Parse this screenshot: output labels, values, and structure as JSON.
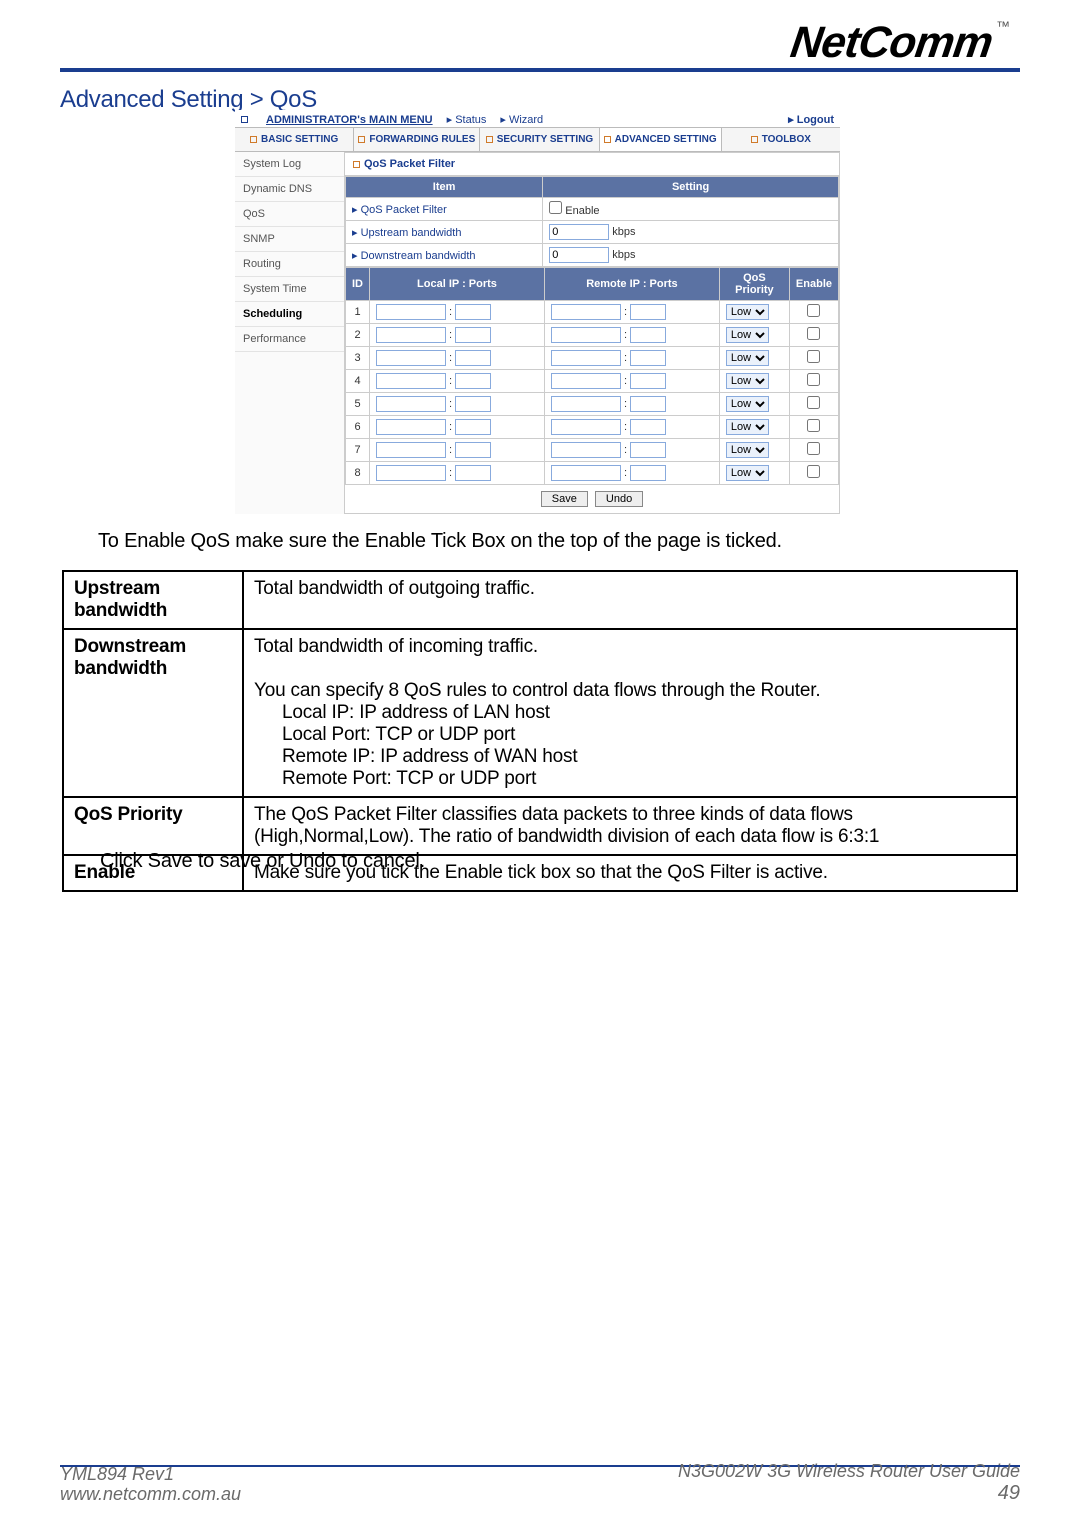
{
  "logo": {
    "text": "NetComm",
    "tm": "™"
  },
  "heading": "Advanced Setting > QoS",
  "router": {
    "topbar": {
      "main_menu": "ADMINISTRATOR's MAIN MENU",
      "status": "Status",
      "wizard": "Wizard",
      "logout": "Logout"
    },
    "tabs": [
      "BASIC SETTING",
      "FORWARDING RULES",
      "SECURITY SETTING",
      "ADVANCED SETTING",
      "TOOLBOX"
    ],
    "active_tab_index": 3,
    "sidebar": [
      "System Log",
      "Dynamic DNS",
      "QoS",
      "SNMP",
      "Routing",
      "System Time",
      "Scheduling",
      "Performance"
    ],
    "sidebar_active_index": 6,
    "panel_title": "QoS Packet Filter",
    "cfg_header": {
      "item": "Item",
      "setting": "Setting"
    },
    "cfg_rows": {
      "qos_pf": {
        "label": "QoS Packet Filter",
        "setting_label": "Enable",
        "checked": false
      },
      "up": {
        "label": "Upstream bandwidth",
        "value": "0",
        "unit": "kbps"
      },
      "down": {
        "label": "Downstream bandwidth",
        "value": "0",
        "unit": "kbps"
      }
    },
    "qos_headers": {
      "id": "ID",
      "local": "Local IP : Ports",
      "remote": "Remote IP : Ports",
      "priority": "QoS Priority",
      "enable": "Enable"
    },
    "qos_rows": [
      {
        "id": 1,
        "priority": "Low",
        "checked": false
      },
      {
        "id": 2,
        "priority": "Low",
        "checked": false
      },
      {
        "id": 3,
        "priority": "Low",
        "checked": false
      },
      {
        "id": 4,
        "priority": "Low",
        "checked": false
      },
      {
        "id": 5,
        "priority": "Low",
        "checked": false
      },
      {
        "id": 6,
        "priority": "Low",
        "checked": false
      },
      {
        "id": 7,
        "priority": "Low",
        "checked": false
      },
      {
        "id": 8,
        "priority": "Low",
        "checked": false
      }
    ],
    "buttons": {
      "save": "Save",
      "undo": "Undo"
    }
  },
  "enable_note": "To Enable QoS make sure the Enable Tick Box on the top of the page is ticked.",
  "desc_table": {
    "rows": [
      {
        "k": "Upstream bandwidth",
        "v": "Total bandwidth of outgoing traffic."
      },
      {
        "k": "Downstream bandwidth",
        "v_lines": [
          "Total bandwidth of incoming traffic.",
          "You can specify 8 QoS rules to control data flows through the Router.",
          "Local IP: IP address of LAN host",
          "Local Port: TCP or UDP port",
          "Remote IP: IP address of WAN host",
          "Remote Port: TCP or UDP port"
        ]
      },
      {
        "k": "QoS Priority",
        "v": "The QoS Packet Filter classifies data packets to three kinds of data flows (High,Normal,Low). The ratio of bandwidth division of each data flow is 6:3:1"
      },
      {
        "k": "Enable",
        "v": "Make sure you tick the Enable tick box so that the QoS Filter is active."
      }
    ]
  },
  "under_note": "Click Save to save or Undo to cancel.",
  "footer": {
    "left1": "YML894 Rev1",
    "left2": "www.netcomm.com.au",
    "right1": "N3G002W 3G Wireless Router User Guide",
    "right2": "49"
  }
}
